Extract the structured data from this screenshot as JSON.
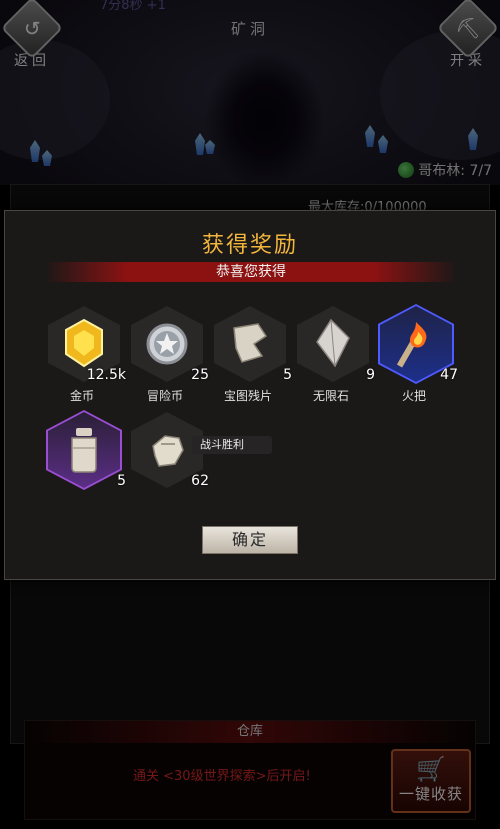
{
  "header": {
    "title": "矿洞",
    "faded_text": "7分8秒 +1",
    "back_label": "返回",
    "collect_label": "开采"
  },
  "status": {
    "goblin_text": "哥布林: 7/7",
    "stock_text": "最大库存:0/100000"
  },
  "warehouse": {
    "title": "仓库",
    "message": "通关 <30级世界探索>后开启!",
    "harvest_label": "一键收获"
  },
  "dialog": {
    "title": "获得奖励",
    "subtitle": "恭喜您获得",
    "confirm_label": "确定",
    "tooltip": "战斗胜利",
    "items": [
      {
        "name": "金币",
        "qty": "12.5k",
        "icon": "gold-gem-icon",
        "rarity": "normal"
      },
      {
        "name": "冒险币",
        "qty": "25",
        "icon": "adventure-coin-icon",
        "rarity": "normal"
      },
      {
        "name": "宝图残片",
        "qty": "5",
        "icon": "map-fragment-icon",
        "rarity": "normal"
      },
      {
        "name": "无限石",
        "qty": "9",
        "icon": "crystal-stone-icon",
        "rarity": "normal"
      },
      {
        "name": "火把",
        "qty": "47",
        "icon": "torch-icon",
        "rarity": "blue"
      },
      {
        "name": "",
        "qty": "5",
        "icon": "jar-icon",
        "rarity": "purple"
      },
      {
        "name": "",
        "qty": "62",
        "icon": "glove-icon",
        "rarity": "normal"
      }
    ]
  },
  "colors": {
    "title_gold": "#f2b63b",
    "banner_red": "#8c1212",
    "warning_red": "#d42b2b"
  }
}
